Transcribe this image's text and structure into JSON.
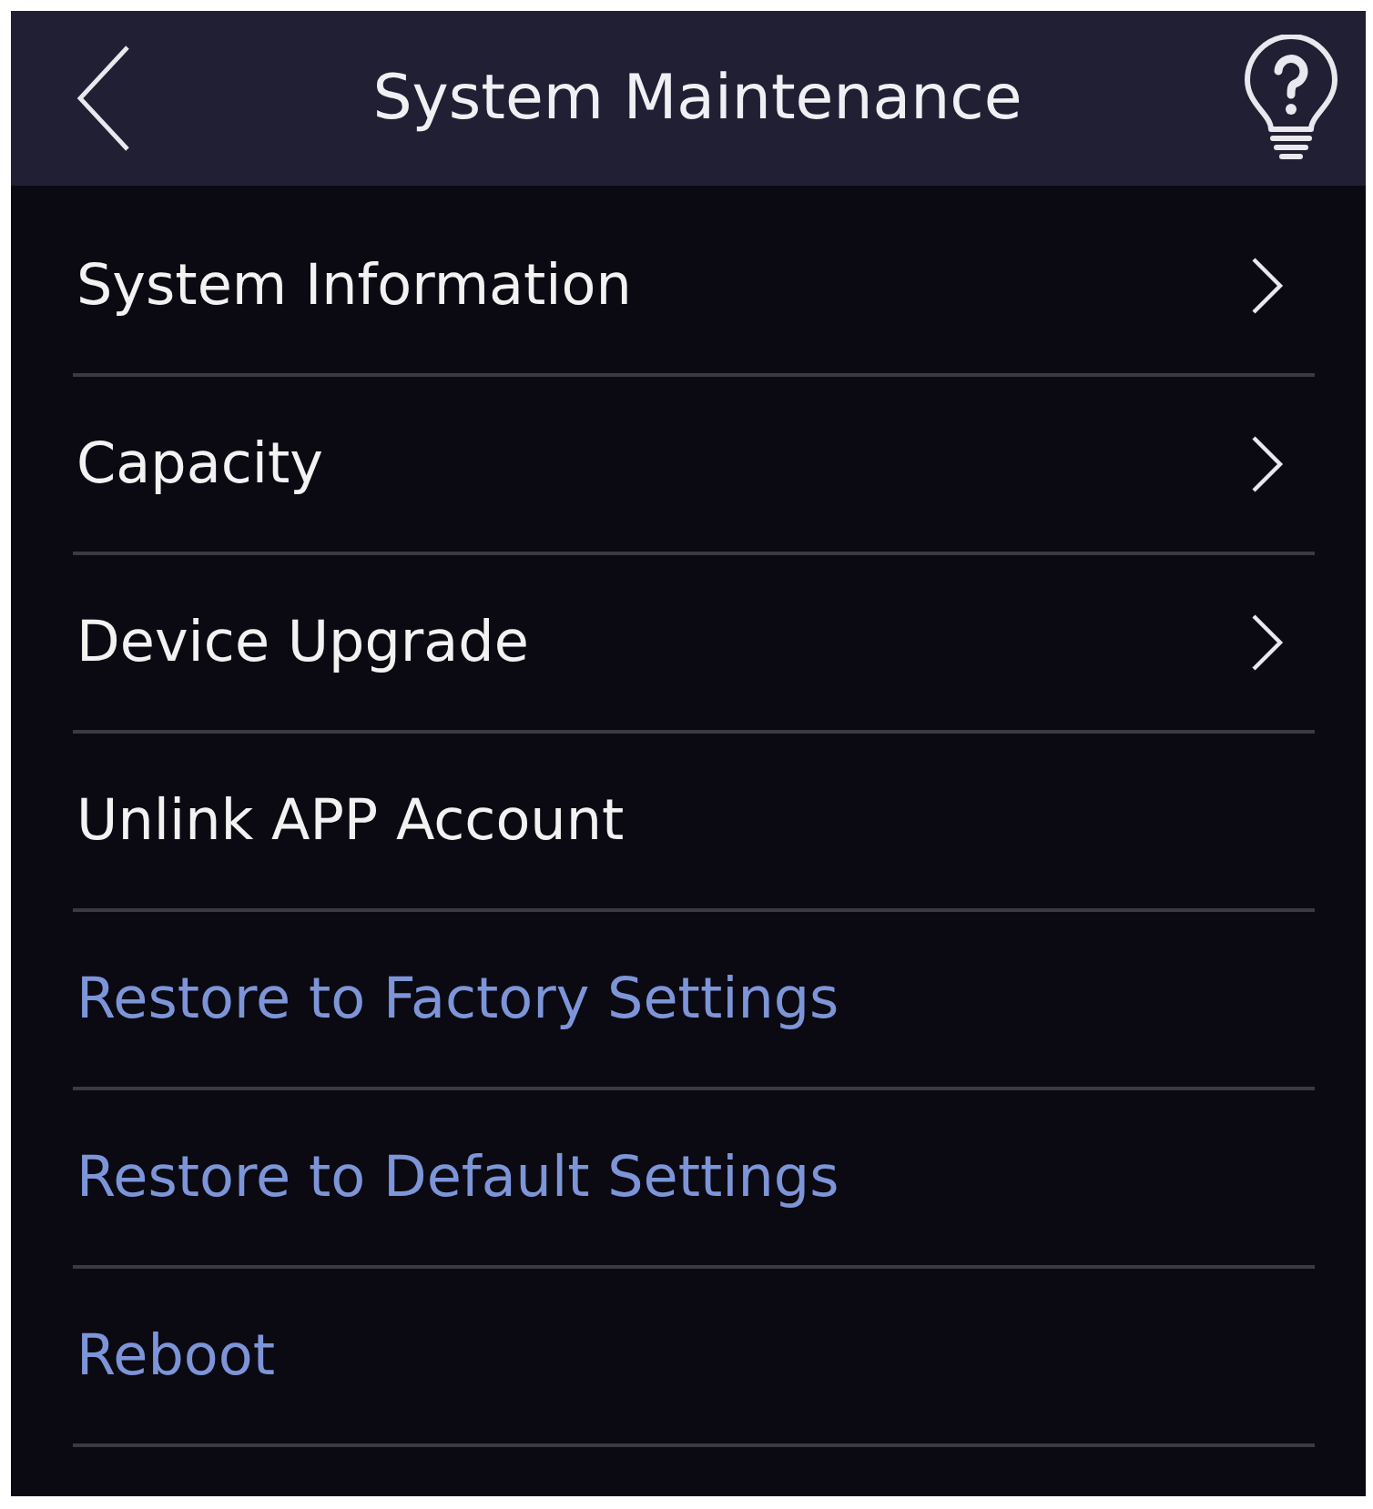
{
  "header": {
    "title": "System Maintenance"
  },
  "menu": [
    {
      "label": "System Information",
      "kind": "submenu"
    },
    {
      "label": "Capacity",
      "kind": "submenu"
    },
    {
      "label": "Device Upgrade",
      "kind": "submenu"
    },
    {
      "label": "Unlink APP Account",
      "kind": "action"
    },
    {
      "label": "Restore to Factory Settings",
      "kind": "reset"
    },
    {
      "label": "Restore to Default Settings",
      "kind": "reset"
    },
    {
      "label": "Reboot",
      "kind": "reset"
    }
  ]
}
